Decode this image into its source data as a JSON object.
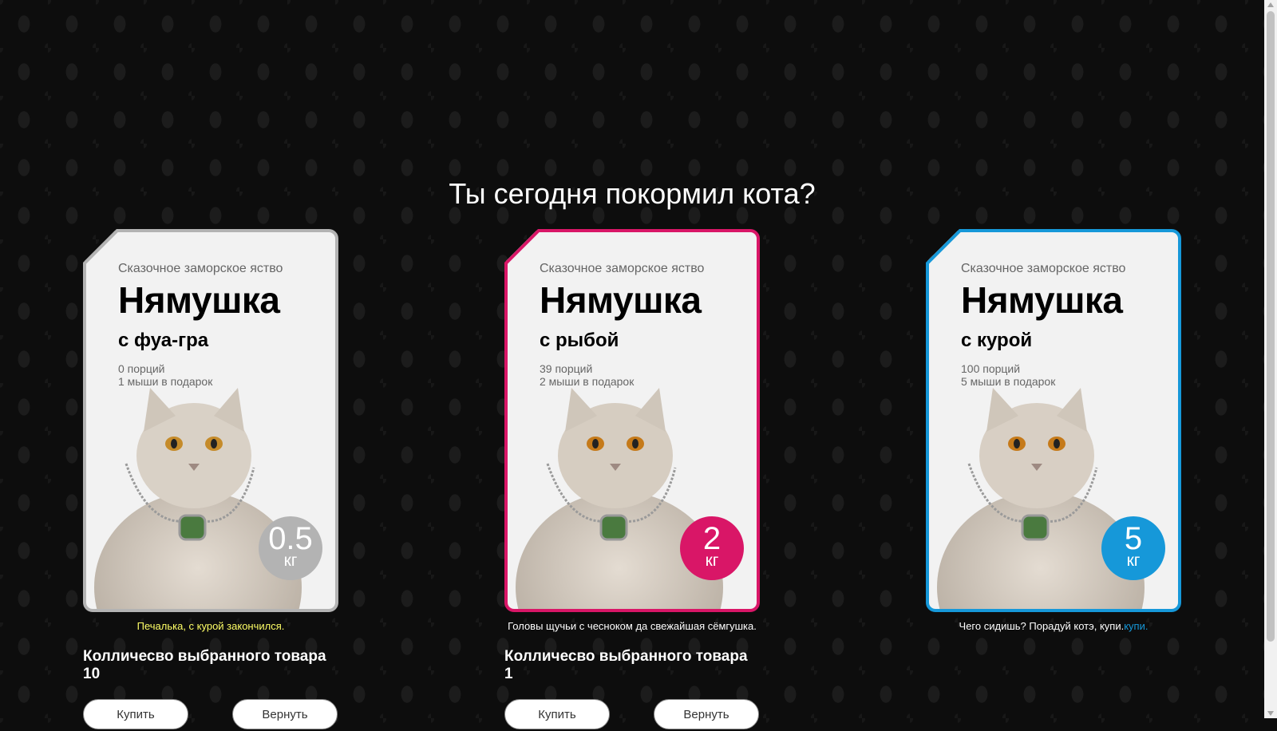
{
  "heading": "Ты сегодня покормил кота?",
  "colors": {
    "default": "#b3b3b3",
    "selected": "#d91667",
    "accent": "#1698d9",
    "sold_out_text": "#ffff66"
  },
  "products": [
    {
      "tagline": "Сказочное заморское яство",
      "brand": "Нямушка",
      "flavor": "с фуа-гра",
      "portions": "0 порций",
      "mice": "1 мыши в подарок",
      "weight": "0.5",
      "unit": "кг",
      "state": "disabled",
      "description": "Печалька, с курой закончился.",
      "quantity_label": "Колличесво выбранного товара 10",
      "buy_label": "Купить",
      "return_label": "Вернуть"
    },
    {
      "tagline": "Сказочное заморское яство",
      "brand": "Нямушка",
      "flavor": "с рыбой",
      "portions": "39 порций",
      "mice": "2 мыши в подарок",
      "weight": "2",
      "unit": "кг",
      "state": "selected",
      "description": "Головы щучьи с чесноком да свежайшая сёмгушка.",
      "quantity_label": "Колличесво выбранного товара 1",
      "buy_label": "Купить",
      "return_label": "Вернуть"
    },
    {
      "tagline": "Сказочное заморское яство",
      "brand": "Нямушка",
      "flavor": "с курой",
      "portions": "100 порций",
      "mice": "5 мыши в подарок",
      "weight": "5",
      "unit": "кг",
      "state": "default",
      "description": "Чего сидишь? Порадуй котэ, купи.",
      "description_link": "купи."
    }
  ]
}
